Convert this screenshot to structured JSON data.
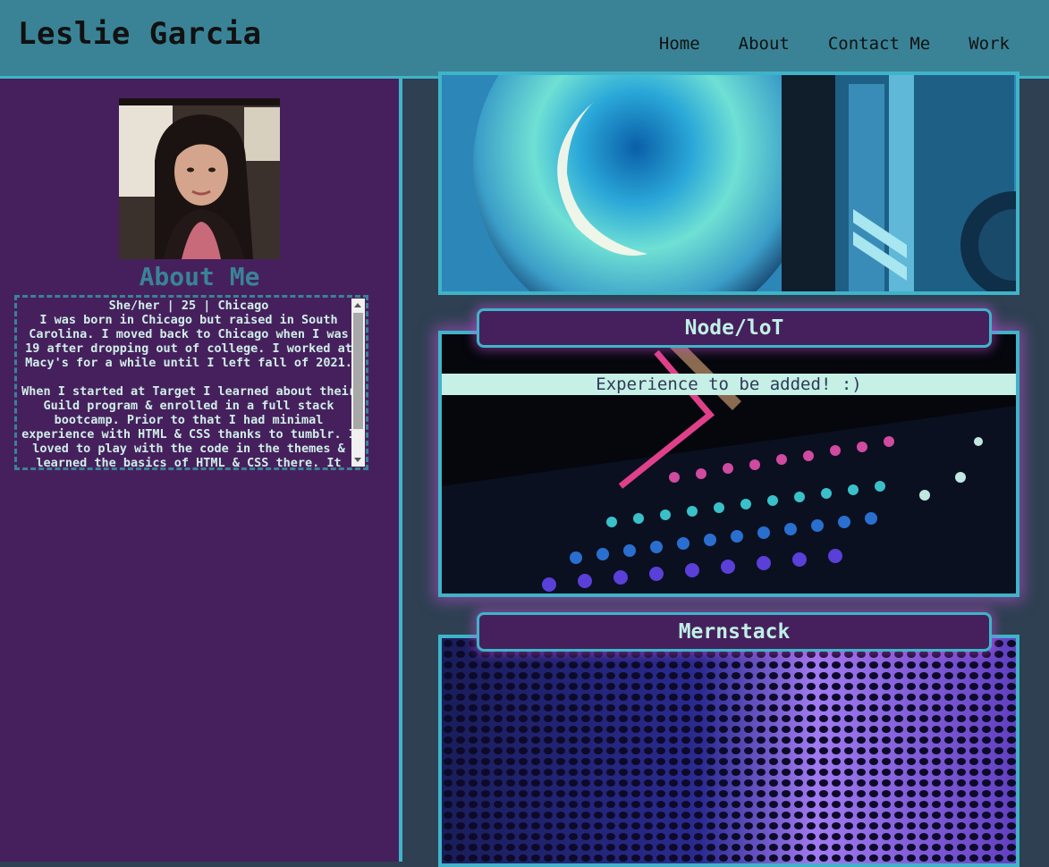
{
  "header": {
    "brand": "Leslie Garcia",
    "nav": [
      "Home",
      "About",
      "Contact Me",
      "Work"
    ]
  },
  "about": {
    "title": "About Me",
    "meta": "She/her | 25 | Chicago",
    "paragraphs": [
      "I was born in Chicago but raised in South Carolina. I moved back to Chicago when I was 19 after dropping out of college. I worked at Macy's for a while until I left fall of 2021.",
      "When I started at Target I learned about their Guild program & enrolled in a full stack bootcamp. Prior to that I had minimal experience with HTML & CSS thanks to tumblr. I loved to play with the code in the themes & learned the basics of HTML & CSS there. It"
    ]
  },
  "projects": [
    {
      "title": "Node/loT",
      "note": "Experience to be added! :)"
    },
    {
      "title": "Mernstack"
    }
  ],
  "colors": {
    "header": "#3a8396",
    "sidebar": "#46205c",
    "accent": "#3fb4c9",
    "background": "#2e4052"
  }
}
